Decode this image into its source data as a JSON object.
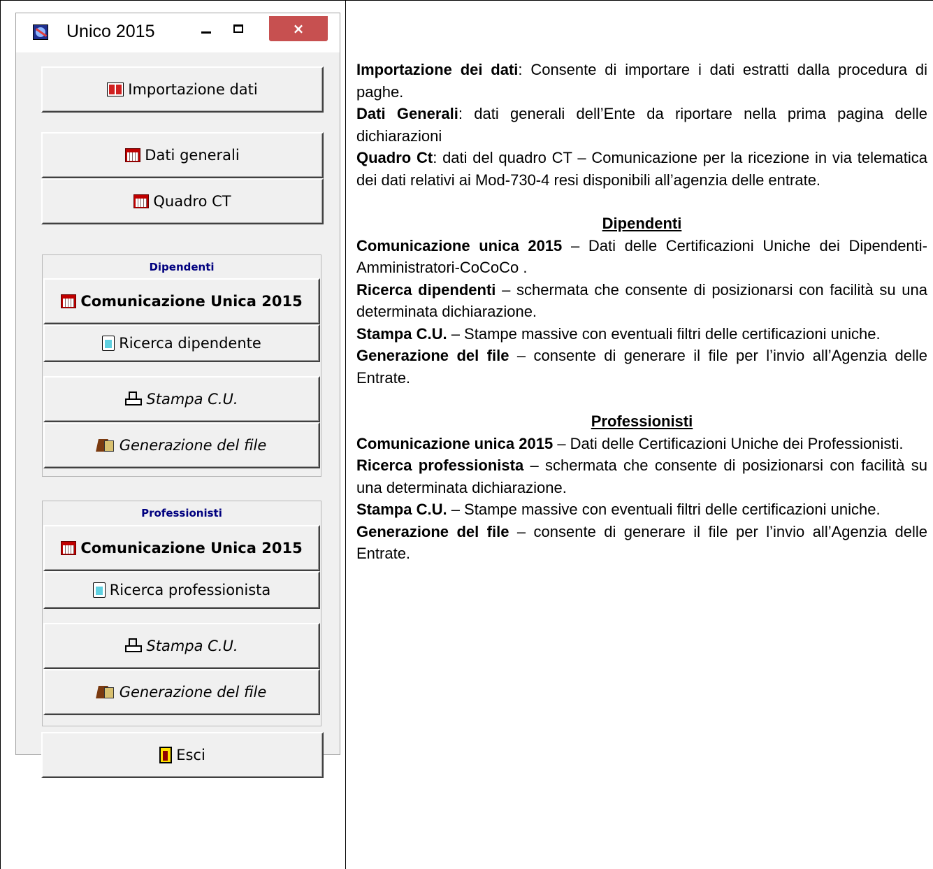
{
  "window": {
    "title": "Unico 2015",
    "close_glyph": "×"
  },
  "buttons": {
    "importazione": "Importazione dati",
    "dati_generali": "Dati generali",
    "quadro_ct": "Quadro CT",
    "esci": "Esci"
  },
  "dipendenti_group": {
    "title": "Dipendenti",
    "comunicazione": "Comunicazione Unica 2015",
    "ricerca": "Ricerca dipendente",
    "stampa": "Stampa C.U.",
    "generazione": "Generazione del file"
  },
  "professionisti_group": {
    "title": "Professionisti",
    "comunicazione": "Comunicazione Unica 2015",
    "ricerca": "Ricerca professionista",
    "stampa": "Stampa C.U.",
    "generazione": "Generazione del file"
  },
  "description": {
    "importazione": {
      "term": "Importazione dei dati",
      "text": ": Consente di importare i dati estratti dalla procedura di paghe."
    },
    "dati_generali": {
      "term": "Dati Generali",
      "text": ": dati generali dell’Ente da riportare nella prima pagina delle dichiarazioni"
    },
    "quadro_ct": {
      "term": "Quadro Ct",
      "text": ": dati del quadro CT – Comunicazione per la ricezione in via telematica dei dati relativi ai Mod-730-4 resi disponibili all’agenzia delle entrate."
    },
    "dipendenti": {
      "heading": "Dipendenti",
      "items": [
        {
          "term": "Comunicazione unica 2015",
          "text": " – Dati delle Certificazioni Uniche dei Dipendenti-Amministratori-CoCoCo ."
        },
        {
          "term": "Ricerca dipendenti",
          "text": " – schermata che consente di posizionarsi con facilità su una determinata dichiarazione."
        },
        {
          "term": "Stampa C.U.",
          "text": " – Stampe massive con eventuali filtri delle certificazioni uniche."
        },
        {
          "term": "Generazione del file",
          "text": " – consente di generare il file per l’invio all’Agenzia delle Entrate."
        }
      ]
    },
    "professionisti": {
      "heading": "Professionisti",
      "items": [
        {
          "term": "Comunicazione unica 2015",
          "text": " – Dati delle Certificazioni Uniche dei Professionisti."
        },
        {
          "term": "Ricerca professionista",
          "text": " – schermata che consente di posizionarsi con facilità su una determinata dichiarazione."
        },
        {
          "term": "Stampa C.U.",
          "text": " – Stampe massive con eventuali filtri delle certificazioni uniche."
        },
        {
          "term": "Generazione del file",
          "text": " – consente di generare il file per l’invio all’Agenzia delle Entrate."
        }
      ]
    }
  }
}
